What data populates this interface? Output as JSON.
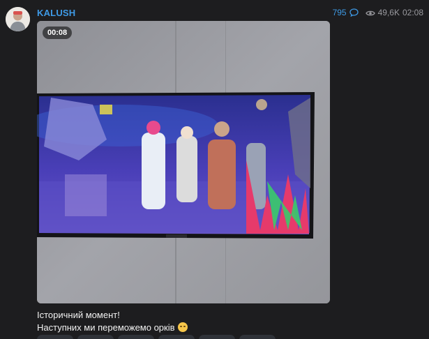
{
  "post": {
    "channel": "KALUSH",
    "comments": "795",
    "views": "49,6K",
    "time": "02:08"
  },
  "video": {
    "duration": "00:08"
  },
  "caption": {
    "line1": "Історичний момент!",
    "line2": "Наступних ми переможемо орків"
  },
  "icons": {
    "avatar": "avatar-photo",
    "comments": "comment-bubble-icon",
    "views": "eye-icon",
    "emoji": "relieved-face-emoji"
  },
  "colors": {
    "accent": "#3e9ae6",
    "background": "#1d1d1f",
    "meta_text": "#9a9a9f"
  }
}
